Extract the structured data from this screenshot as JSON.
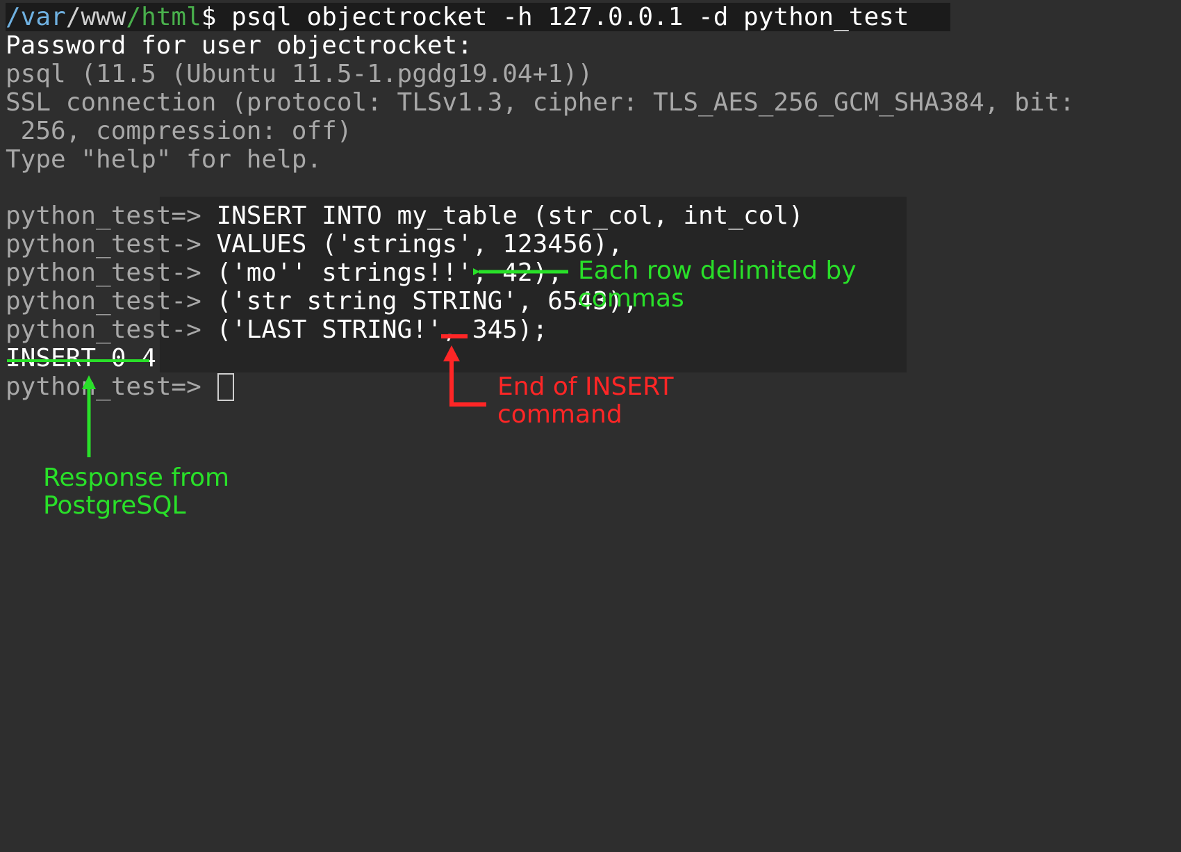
{
  "prompt": {
    "path_var": "/var",
    "path_www": "/www",
    "path_html": "/html",
    "marker": "$",
    "command": " psql objectrocket -h 127.0.0.1 -d python_test"
  },
  "lines": {
    "pw_prompt": "Password for user objectrocket:",
    "psql_ver": "psql (11.5 (Ubuntu 11.5-1.pgdg19.04+1))",
    "ssl1": "SSL connection (protocol: TLSv1.3, cipher: TLS_AES_256_GCM_SHA384, bit:",
    "ssl2": " 256, compression: off)",
    "help": "Type \"help\" for help."
  },
  "session": {
    "p1a": "python_test=>",
    "p1b": " INSERT INTO my_table (str_col, int_col)",
    "p2a": "python_test->",
    "p2b": " VALUES ('strings', 123456),",
    "p3a": "python_test->",
    "p3b": " ('mo'' strings!!', 42),",
    "p4a": "python_test->",
    "p4b": " ('str string STRING', 6543),",
    "p5a": "python_test->",
    "p5b": " ('LAST STRING!', 345);",
    "response": "INSERT 0 4",
    "next_prompt": "python_test=> "
  },
  "annotations": {
    "commas1": "Each row delimited by",
    "commas2": "commas",
    "end1": "End of INSERT",
    "end2": "command",
    "resp1": "Response from",
    "resp2": "PostgreSQL"
  }
}
